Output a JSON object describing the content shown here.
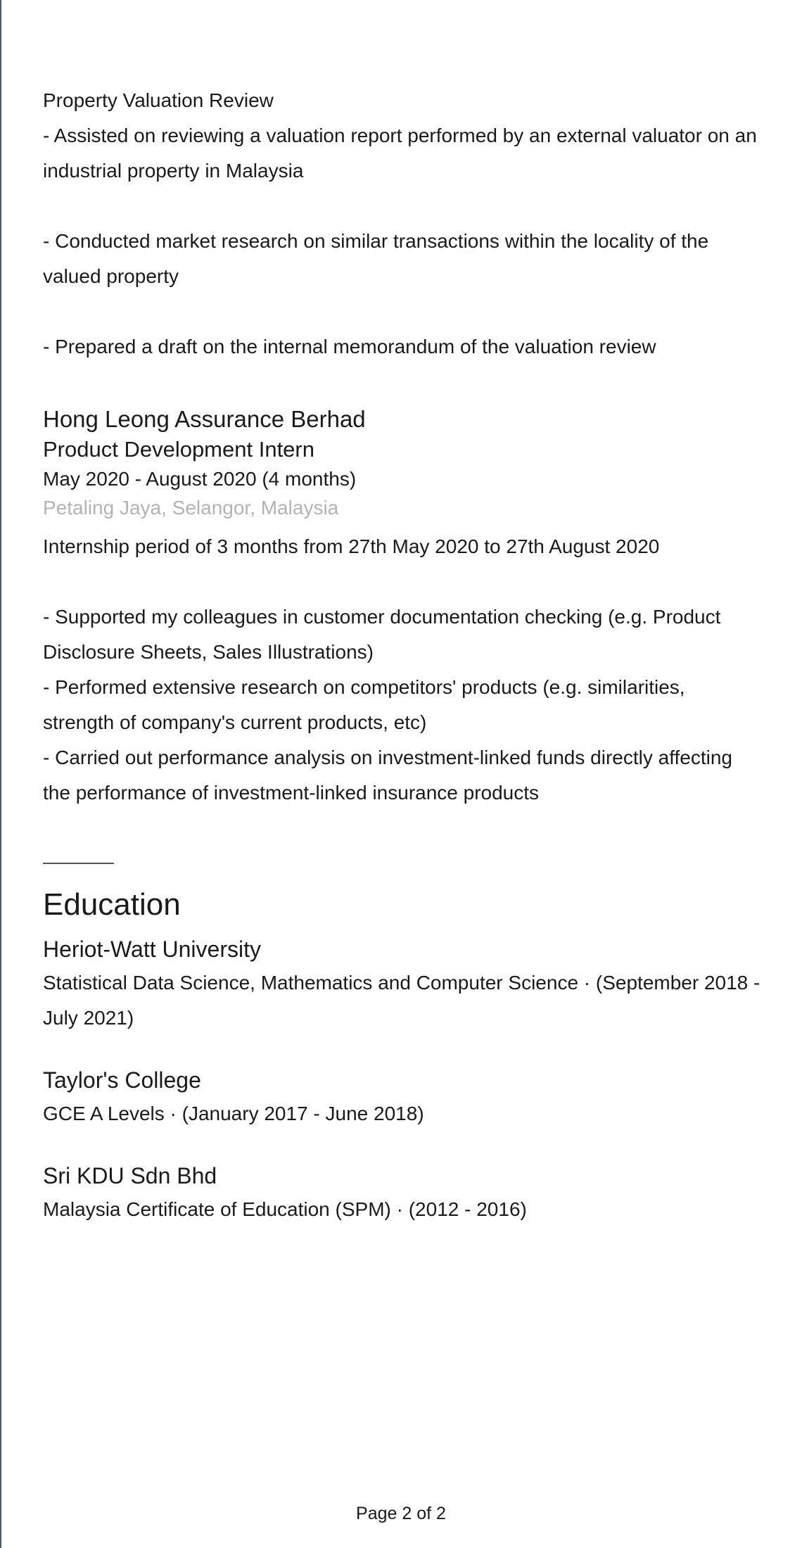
{
  "project": {
    "title": "Property Valuation Review",
    "bullets": [
      "- Assisted on reviewing a valuation report performed by an external valuator on an industrial property in Malaysia",
      "- Conducted market research on similar transactions within the locality of the valued property",
      "- Prepared a draft on the internal memorandum of the valuation review"
    ]
  },
  "job": {
    "company": "Hong Leong Assurance Berhad",
    "title": "Product Development Intern",
    "dates": "May 2020 - August 2020 (4 months)",
    "location": "Petaling Jaya, Selangor, Malaysia",
    "summary": "Internship period of 3 months from 27th May 2020 to 27th August 2020",
    "bullets": [
      "- Supported my colleagues in customer documentation checking (e.g. Product Disclosure Sheets, Sales Illustrations)",
      "- Performed extensive research on competitors' products (e.g. similarities, strength of company's current products, etc)",
      "- Carried out performance analysis on investment-linked funds directly affecting the performance of investment-linked insurance products"
    ]
  },
  "education": {
    "heading": "Education",
    "entries": [
      {
        "school": "Heriot-Watt University",
        "detail": "Statistical Data Science, Mathematics and Computer Science · (September 2018 - July 2021)"
      },
      {
        "school": "Taylor's College",
        "detail": "GCE A Levels  · (January 2017 - June 2018)"
      },
      {
        "school": "Sri KDU Sdn Bhd",
        "detail": "Malaysia Certificate of Education (SPM)  · (2012 - 2016)"
      }
    ]
  },
  "footer": {
    "page_label": "Page 2 of 2"
  }
}
